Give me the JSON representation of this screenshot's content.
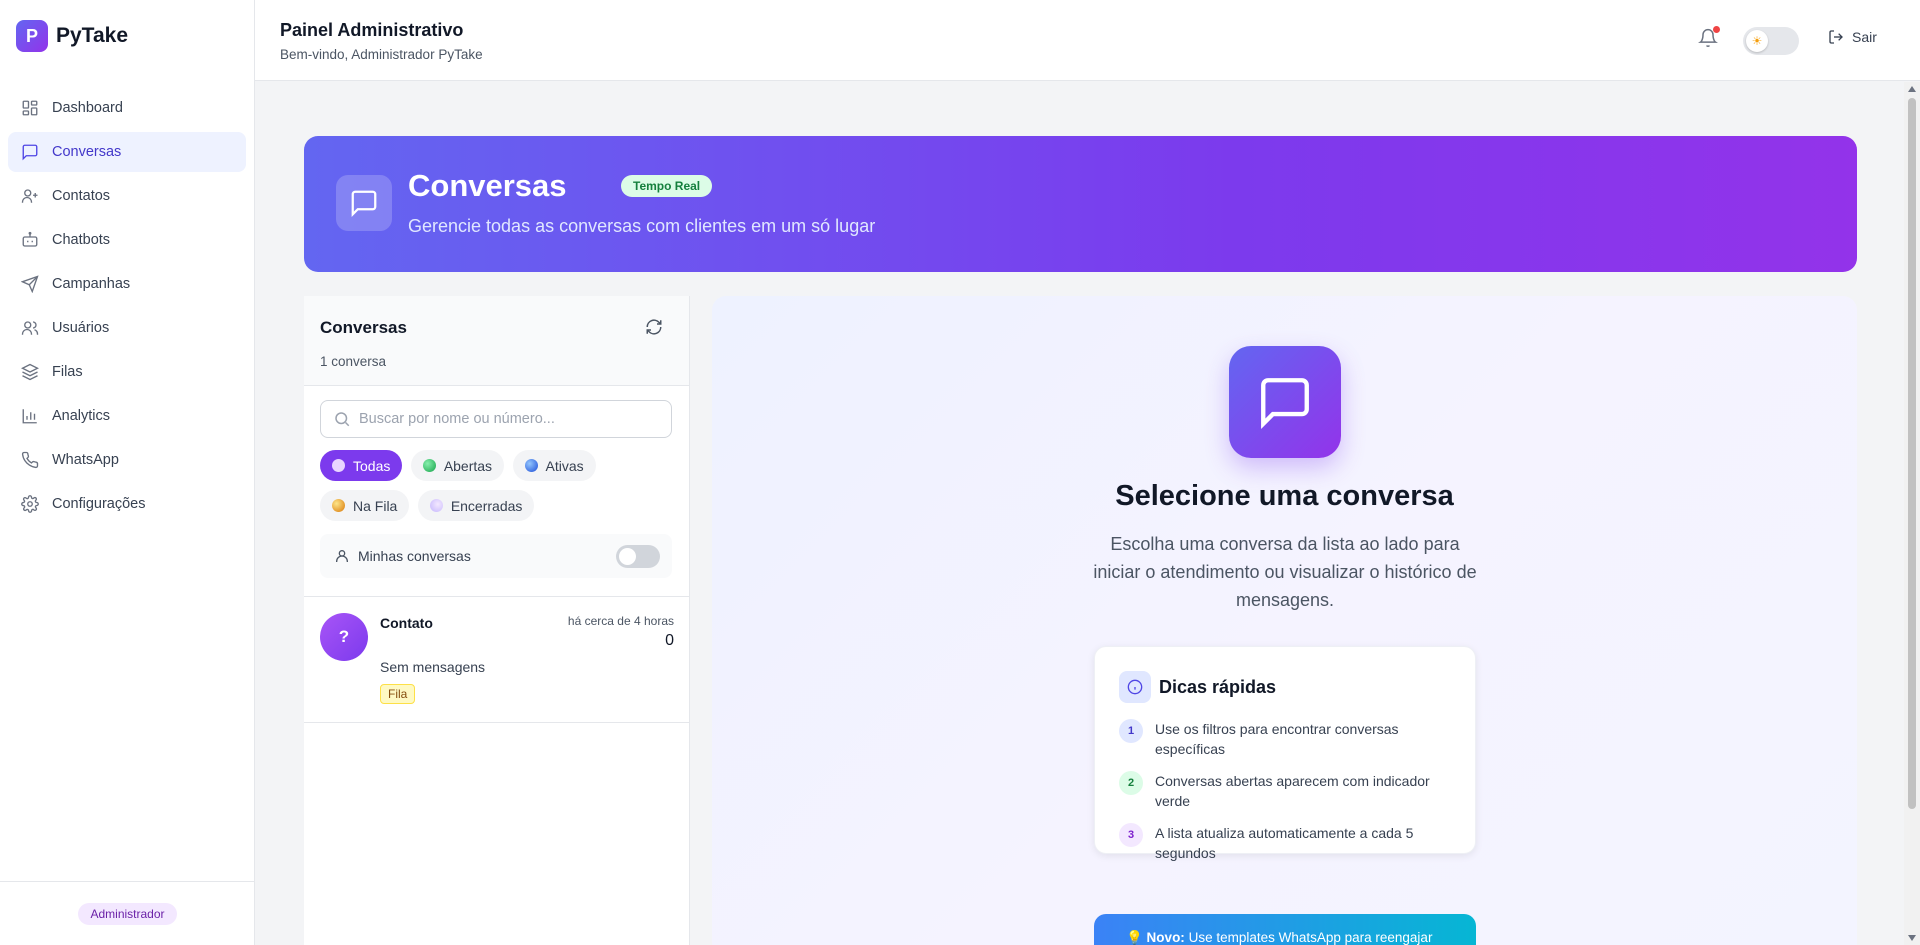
{
  "app": {
    "logo_letter": "P",
    "name": "PyTake"
  },
  "sidebar": {
    "items": [
      {
        "label": "Dashboard",
        "icon": "dashboard-icon",
        "active": false
      },
      {
        "label": "Conversas",
        "icon": "chat-icon",
        "active": true
      },
      {
        "label": "Contatos",
        "icon": "user-plus-icon",
        "active": false
      },
      {
        "label": "Chatbots",
        "icon": "bot-icon",
        "active": false
      },
      {
        "label": "Campanhas",
        "icon": "send-icon",
        "active": false
      },
      {
        "label": "Usuários",
        "icon": "users-icon",
        "active": false
      },
      {
        "label": "Filas",
        "icon": "layers-icon",
        "active": false
      },
      {
        "label": "Analytics",
        "icon": "bar-chart-icon",
        "active": false
      },
      {
        "label": "WhatsApp",
        "icon": "phone-icon",
        "active": false
      },
      {
        "label": "Configurações",
        "icon": "gear-icon",
        "active": false
      }
    ],
    "role": "Administrador"
  },
  "header": {
    "title": "Painel Administrativo",
    "subtitle": "Bem-vindo, Administrador PyTake",
    "logout_label": "Sair",
    "has_notification": true
  },
  "hero": {
    "title": "Conversas",
    "badge": "Tempo Real",
    "subtitle": "Gerencie todas as conversas com clientes em um só lugar"
  },
  "list": {
    "title": "Conversas",
    "count": "1 conversa",
    "search_placeholder": "Buscar por nome ou número...",
    "search_value": "",
    "filters": [
      {
        "label": "Todas",
        "active": true,
        "color": "#ffffff"
      },
      {
        "label": "Abertas",
        "active": false,
        "color": "#22c55e"
      },
      {
        "label": "Ativas",
        "active": false,
        "color": "#3b82f6"
      },
      {
        "label": "Na Fila",
        "active": false,
        "color": "#eab308"
      },
      {
        "label": "Encerradas",
        "active": false,
        "color": "#d8b4fe"
      }
    ],
    "mine_label": "Minhas conversas",
    "mine_enabled": false,
    "conversations": [
      {
        "avatar": "?",
        "name": "Contato",
        "time": "há cerca de 4 horas",
        "unread": "0",
        "last_message": "Sem mensagens",
        "tag": "Fila"
      }
    ]
  },
  "empty": {
    "title": "Selecione uma conversa",
    "description": "Escolha uma conversa da lista ao lado para iniciar o atendimento ou visualizar o histórico de mensagens.",
    "tips_title": "Dicas rápidas",
    "tips": [
      {
        "num": "1",
        "text": "Use os filtros para encontrar conversas específicas",
        "bg": "#e0e7ff",
        "fg": "#4338ca"
      },
      {
        "num": "2",
        "text": "Conversas abertas aparecem com indicador verde",
        "bg": "#dcfce7",
        "fg": "#15803d"
      },
      {
        "num": "3",
        "text": "A lista atualiza automaticamente a cada 5 segundos",
        "bg": "#f3e8ff",
        "fg": "#7e22ce"
      }
    ],
    "novo_prefix": "💡 Novo:",
    "novo_text": " Use templates WhatsApp para reengajar"
  },
  "colors": {
    "accent": "#7c3aed",
    "primary": "#6366f1",
    "sidebar_active_bg": "#eef2ff",
    "notification_dot": "#ef4444"
  }
}
